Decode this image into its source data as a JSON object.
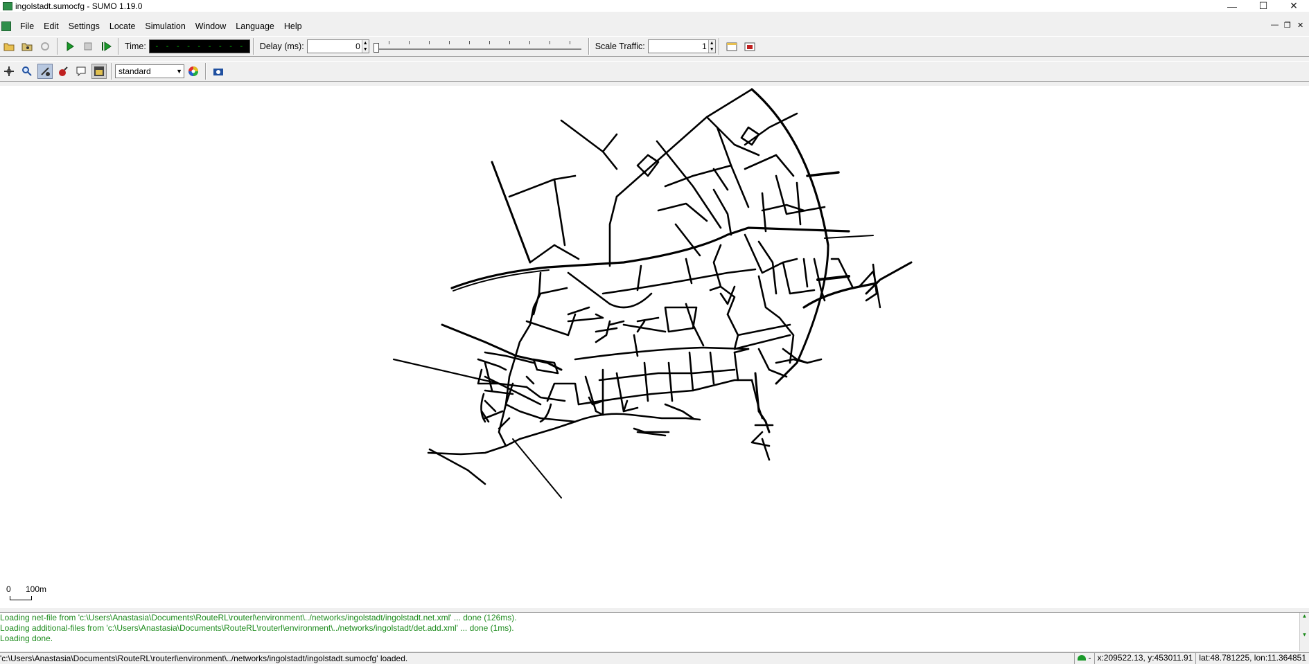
{
  "window": {
    "title": "ingolstadt.sumocfg - SUMO 1.19.0",
    "minimize_glyph": "—",
    "maximize_glyph": "☐",
    "close_glyph": "✕"
  },
  "menubar": {
    "items": [
      {
        "label": "File"
      },
      {
        "label": "Edit"
      },
      {
        "label": "Settings"
      },
      {
        "label": "Locate"
      },
      {
        "label": "Simulation"
      },
      {
        "label": "Window"
      },
      {
        "label": "Language"
      },
      {
        "label": "Help"
      }
    ],
    "mdi_controls": [
      "—",
      "❐",
      "✕"
    ]
  },
  "toolbar": {
    "time_label": "Time:",
    "time_value": "- - - - - - - - - - - - - -",
    "delay_label": "Delay (ms):",
    "delay_value": "0",
    "scale_label": "Scale Traffic:",
    "scale_value": "1",
    "view_scheme": "standard"
  },
  "canvas": {
    "scale_legend": {
      "zero": "0",
      "distance": "100m"
    }
  },
  "log": {
    "lines": [
      "Loading net-file from 'c:\\Users\\Anastasia\\Documents\\RouteRL\\routerl\\environment\\../networks/ingolstadt/ingolstadt.net.xml' ... done (126ms).",
      "Loading additional-files from 'c:\\Users\\Anastasia\\Documents\\RouteRL\\routerl\\environment\\../networks/ingolstadt/det.add.xml' ... done (1ms).",
      "Loading done."
    ]
  },
  "statusbar": {
    "message": "'c:\\Users\\Anastasia\\Documents\\RouteRL\\routerl\\environment\\../networks/ingolstadt/ingolstadt.sumocfg' loaded.",
    "indicator": "-",
    "xy": "x:209522.13, y:453011.91",
    "latlon": "lat:48.781225, lon:11.364851"
  },
  "colors": {
    "log_text": "#1b8a1b",
    "time_digits": "#00c000",
    "network_edges": "#000000"
  }
}
